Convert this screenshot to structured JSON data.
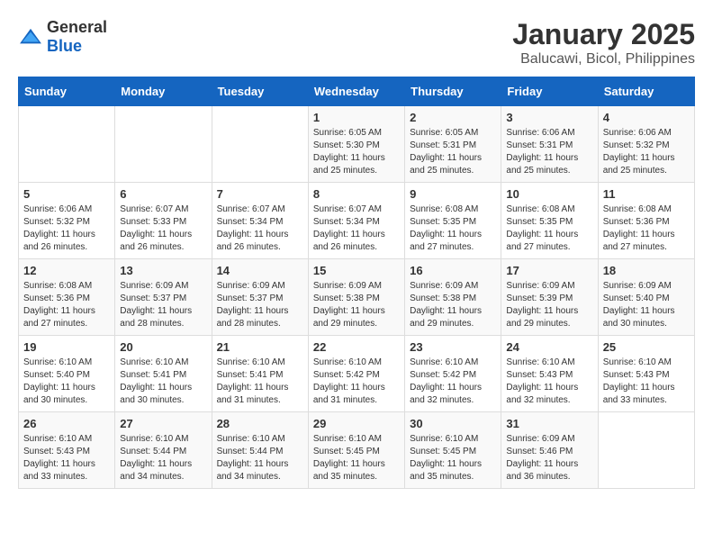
{
  "header": {
    "logo_general": "General",
    "logo_blue": "Blue",
    "title": "January 2025",
    "subtitle": "Balucawi, Bicol, Philippines"
  },
  "weekdays": [
    "Sunday",
    "Monday",
    "Tuesday",
    "Wednesday",
    "Thursday",
    "Friday",
    "Saturday"
  ],
  "weeks": [
    [
      {
        "day": "",
        "sunrise": "",
        "sunset": "",
        "daylight": ""
      },
      {
        "day": "",
        "sunrise": "",
        "sunset": "",
        "daylight": ""
      },
      {
        "day": "",
        "sunrise": "",
        "sunset": "",
        "daylight": ""
      },
      {
        "day": "1",
        "sunrise": "Sunrise: 6:05 AM",
        "sunset": "Sunset: 5:30 PM",
        "daylight": "Daylight: 11 hours and 25 minutes."
      },
      {
        "day": "2",
        "sunrise": "Sunrise: 6:05 AM",
        "sunset": "Sunset: 5:31 PM",
        "daylight": "Daylight: 11 hours and 25 minutes."
      },
      {
        "day": "3",
        "sunrise": "Sunrise: 6:06 AM",
        "sunset": "Sunset: 5:31 PM",
        "daylight": "Daylight: 11 hours and 25 minutes."
      },
      {
        "day": "4",
        "sunrise": "Sunrise: 6:06 AM",
        "sunset": "Sunset: 5:32 PM",
        "daylight": "Daylight: 11 hours and 25 minutes."
      }
    ],
    [
      {
        "day": "5",
        "sunrise": "Sunrise: 6:06 AM",
        "sunset": "Sunset: 5:32 PM",
        "daylight": "Daylight: 11 hours and 26 minutes."
      },
      {
        "day": "6",
        "sunrise": "Sunrise: 6:07 AM",
        "sunset": "Sunset: 5:33 PM",
        "daylight": "Daylight: 11 hours and 26 minutes."
      },
      {
        "day": "7",
        "sunrise": "Sunrise: 6:07 AM",
        "sunset": "Sunset: 5:34 PM",
        "daylight": "Daylight: 11 hours and 26 minutes."
      },
      {
        "day": "8",
        "sunrise": "Sunrise: 6:07 AM",
        "sunset": "Sunset: 5:34 PM",
        "daylight": "Daylight: 11 hours and 26 minutes."
      },
      {
        "day": "9",
        "sunrise": "Sunrise: 6:08 AM",
        "sunset": "Sunset: 5:35 PM",
        "daylight": "Daylight: 11 hours and 27 minutes."
      },
      {
        "day": "10",
        "sunrise": "Sunrise: 6:08 AM",
        "sunset": "Sunset: 5:35 PM",
        "daylight": "Daylight: 11 hours and 27 minutes."
      },
      {
        "day": "11",
        "sunrise": "Sunrise: 6:08 AM",
        "sunset": "Sunset: 5:36 PM",
        "daylight": "Daylight: 11 hours and 27 minutes."
      }
    ],
    [
      {
        "day": "12",
        "sunrise": "Sunrise: 6:08 AM",
        "sunset": "Sunset: 5:36 PM",
        "daylight": "Daylight: 11 hours and 27 minutes."
      },
      {
        "day": "13",
        "sunrise": "Sunrise: 6:09 AM",
        "sunset": "Sunset: 5:37 PM",
        "daylight": "Daylight: 11 hours and 28 minutes."
      },
      {
        "day": "14",
        "sunrise": "Sunrise: 6:09 AM",
        "sunset": "Sunset: 5:37 PM",
        "daylight": "Daylight: 11 hours and 28 minutes."
      },
      {
        "day": "15",
        "sunrise": "Sunrise: 6:09 AM",
        "sunset": "Sunset: 5:38 PM",
        "daylight": "Daylight: 11 hours and 29 minutes."
      },
      {
        "day": "16",
        "sunrise": "Sunrise: 6:09 AM",
        "sunset": "Sunset: 5:38 PM",
        "daylight": "Daylight: 11 hours and 29 minutes."
      },
      {
        "day": "17",
        "sunrise": "Sunrise: 6:09 AM",
        "sunset": "Sunset: 5:39 PM",
        "daylight": "Daylight: 11 hours and 29 minutes."
      },
      {
        "day": "18",
        "sunrise": "Sunrise: 6:09 AM",
        "sunset": "Sunset: 5:40 PM",
        "daylight": "Daylight: 11 hours and 30 minutes."
      }
    ],
    [
      {
        "day": "19",
        "sunrise": "Sunrise: 6:10 AM",
        "sunset": "Sunset: 5:40 PM",
        "daylight": "Daylight: 11 hours and 30 minutes."
      },
      {
        "day": "20",
        "sunrise": "Sunrise: 6:10 AM",
        "sunset": "Sunset: 5:41 PM",
        "daylight": "Daylight: 11 hours and 30 minutes."
      },
      {
        "day": "21",
        "sunrise": "Sunrise: 6:10 AM",
        "sunset": "Sunset: 5:41 PM",
        "daylight": "Daylight: 11 hours and 31 minutes."
      },
      {
        "day": "22",
        "sunrise": "Sunrise: 6:10 AM",
        "sunset": "Sunset: 5:42 PM",
        "daylight": "Daylight: 11 hours and 31 minutes."
      },
      {
        "day": "23",
        "sunrise": "Sunrise: 6:10 AM",
        "sunset": "Sunset: 5:42 PM",
        "daylight": "Daylight: 11 hours and 32 minutes."
      },
      {
        "day": "24",
        "sunrise": "Sunrise: 6:10 AM",
        "sunset": "Sunset: 5:43 PM",
        "daylight": "Daylight: 11 hours and 32 minutes."
      },
      {
        "day": "25",
        "sunrise": "Sunrise: 6:10 AM",
        "sunset": "Sunset: 5:43 PM",
        "daylight": "Daylight: 11 hours and 33 minutes."
      }
    ],
    [
      {
        "day": "26",
        "sunrise": "Sunrise: 6:10 AM",
        "sunset": "Sunset: 5:43 PM",
        "daylight": "Daylight: 11 hours and 33 minutes."
      },
      {
        "day": "27",
        "sunrise": "Sunrise: 6:10 AM",
        "sunset": "Sunset: 5:44 PM",
        "daylight": "Daylight: 11 hours and 34 minutes."
      },
      {
        "day": "28",
        "sunrise": "Sunrise: 6:10 AM",
        "sunset": "Sunset: 5:44 PM",
        "daylight": "Daylight: 11 hours and 34 minutes."
      },
      {
        "day": "29",
        "sunrise": "Sunrise: 6:10 AM",
        "sunset": "Sunset: 5:45 PM",
        "daylight": "Daylight: 11 hours and 35 minutes."
      },
      {
        "day": "30",
        "sunrise": "Sunrise: 6:10 AM",
        "sunset": "Sunset: 5:45 PM",
        "daylight": "Daylight: 11 hours and 35 minutes."
      },
      {
        "day": "31",
        "sunrise": "Sunrise: 6:09 AM",
        "sunset": "Sunset: 5:46 PM",
        "daylight": "Daylight: 11 hours and 36 minutes."
      },
      {
        "day": "",
        "sunrise": "",
        "sunset": "",
        "daylight": ""
      }
    ]
  ]
}
